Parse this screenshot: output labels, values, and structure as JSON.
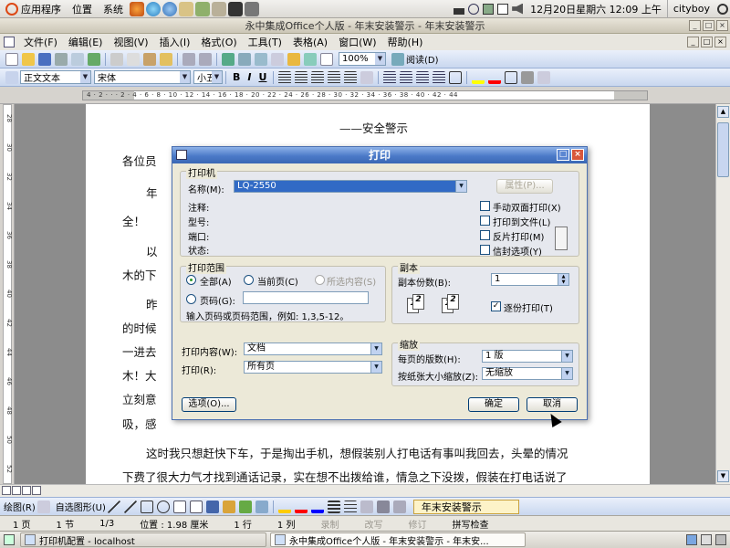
{
  "panel": {
    "apps": "应用程序",
    "places": "位置",
    "system": "系统",
    "clock": "12月20日星期六 12:09 上午",
    "user": "cityboy"
  },
  "window": {
    "title": "永中集成Office个人版 - 年末安装警示 - 年末安装警示"
  },
  "menu": {
    "items": [
      "文件(F)",
      "编辑(E)",
      "视图(V)",
      "插入(I)",
      "格式(O)",
      "工具(T)",
      "表格(A)",
      "窗口(W)",
      "帮助(H)"
    ]
  },
  "toolbar": {
    "zoom": "100%",
    "read": "阅读(D)",
    "style": "正文文本",
    "font": "宋体",
    "size": "小五",
    "bold": "B",
    "italic": "I",
    "underline": "U"
  },
  "ruler": {
    "text": "4 · 2 · · · 2 · 4 · 6 · 8 · 10 · 12 · 14 · 16 · 18 · 20 · 22 · 24 · 26 · 28 · 30 · 32 · 34 · 36 · 38 · 40 · 42 · 44"
  },
  "vruler": {
    "ticks": [
      "28",
      "30",
      "32",
      "34",
      "36",
      "38",
      "40",
      "42",
      "44",
      "46",
      "48",
      "50",
      "52"
    ]
  },
  "document": {
    "heading": "——安全警示",
    "lines": [
      "各位员",
      "年",
      "全！",
      "以",
      "木的下",
      "昨",
      "的时候",
      "一进去",
      "木！大",
      "立刻意",
      "吸，感",
      "这时我只想赶快下车，于是掏出手机，想假装别人打电话有事叫我回去，头晕的情况",
      "下费了很大力气才找到通话记录，实在想不出拨给谁，情急之下没拨，假装在打电话说了"
    ]
  },
  "dialog": {
    "title": "打印",
    "printer_group": "打印机",
    "name_label": "名称(M):",
    "printer_name": "LQ-2550",
    "properties_btn": "属性(P)...",
    "comment_label": "注释:",
    "type_label": "型号:",
    "port_label": "端口:",
    "status_label": "状态:",
    "manual_duplex": "手动双面打印(X)",
    "print_to_file": "打印到文件(L)",
    "reverse_print": "反片打印(M)",
    "envelope_option": "信封选项(Y)",
    "range_group": "打印范围",
    "all": "全部(A)",
    "current_page": "当前页(C)",
    "selection": "所选内容(S)",
    "pages": "页码(G):",
    "pages_hint": "输入页码或页码范围，例如: 1,3,5-12。",
    "copies_group": "副本",
    "copies_label": "副本份数(B):",
    "copies_value": "1",
    "collate": "逐份打印(T)",
    "print_what_label": "打印内容(W):",
    "print_what_value": "文档",
    "print_label": "打印(R):",
    "print_value": "所有页",
    "zoom_group": "缩放",
    "pages_per_sheet_label": "每页的版数(H):",
    "pages_per_sheet_value": "1 版",
    "scale_label": "按纸张大小缩放(Z):",
    "scale_value": "无缩放",
    "options_btn": "选项(O)...",
    "ok_btn": "确定",
    "cancel_btn": "取消"
  },
  "drawbar": {
    "draw": "绘图(R)",
    "autoshape": "自选图形(U)",
    "task_pane": "年末安装警示"
  },
  "status": {
    "page": "1 页",
    "section": "1 节",
    "pos": "1/3",
    "location": "位置 : 1.98 厘米",
    "line": "1 行",
    "col": "1 列",
    "rec": "录制",
    "trk": "改写",
    "ovr": "修订",
    "spell": "拼写检查"
  },
  "taskbar": {
    "task1": "打印机配置 - localhost",
    "task2": "永中集成Office个人版 - 年末安装警示 - 年末安..."
  },
  "colors": {
    "dialog_title": "#4b7ac8",
    "toolbar_bg": "#c9d7ef",
    "selection": "#316ac5"
  }
}
